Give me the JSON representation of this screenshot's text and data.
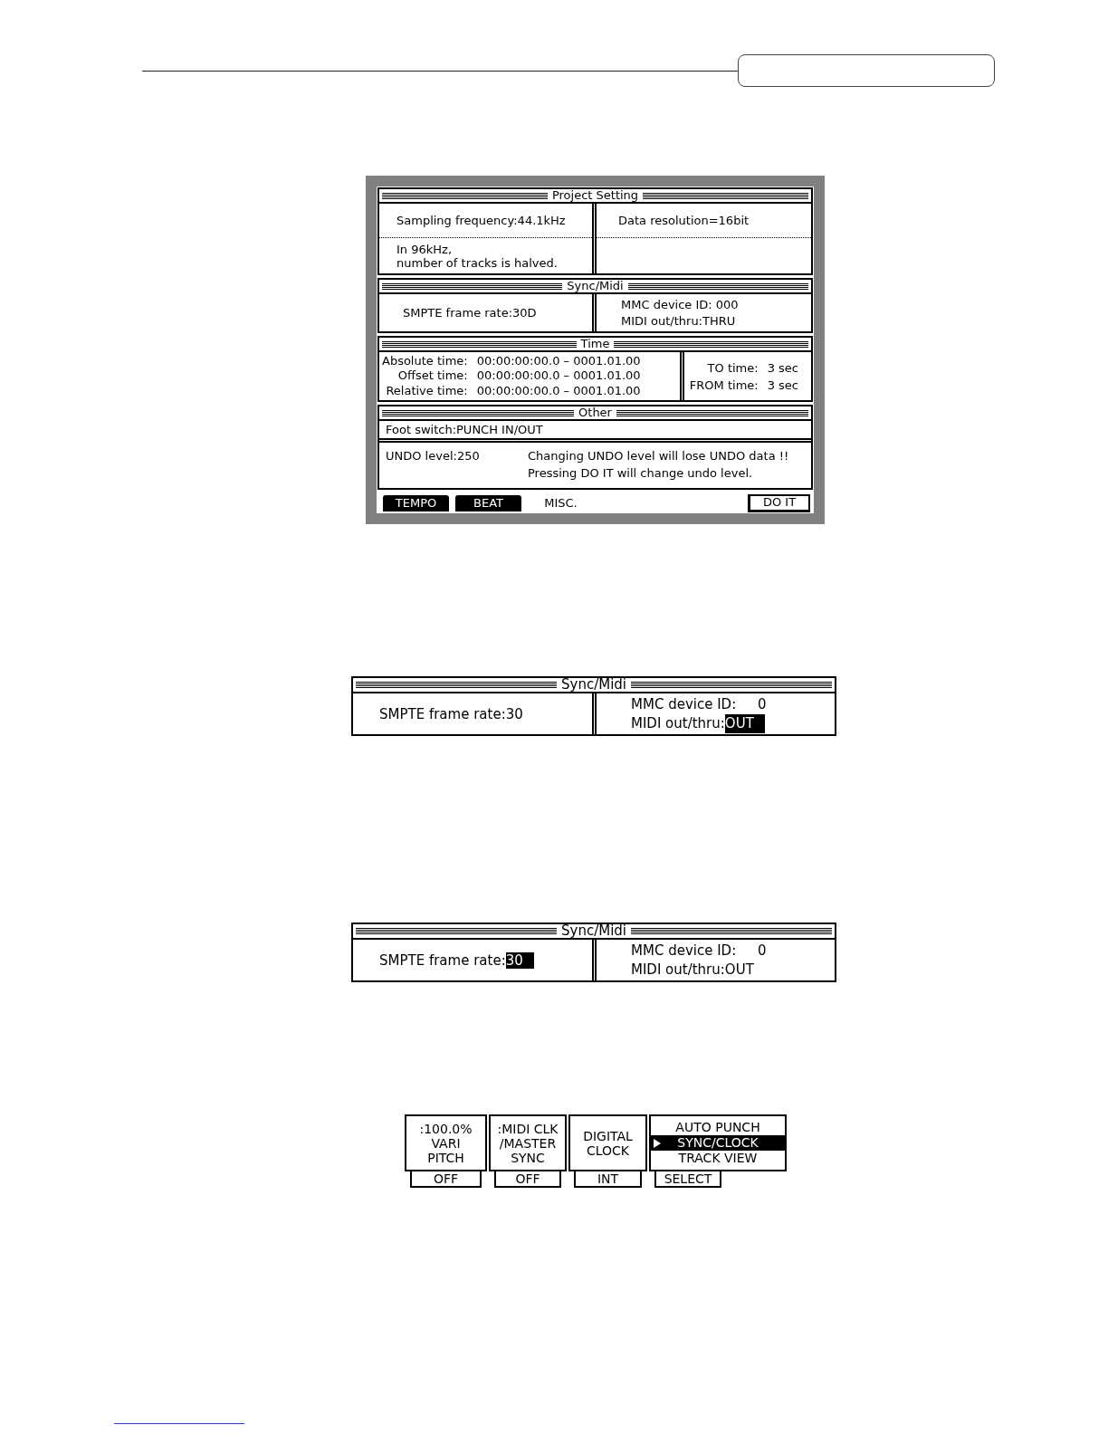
{
  "main_screen": {
    "project_setting": {
      "title": "Project Setting",
      "sampling_frequency": "Sampling frequency:44.1kHz",
      "data_resolution": "Data resolution=16bit",
      "note": [
        "In 96kHz,",
        "number of tracks is halved."
      ]
    },
    "sync_midi": {
      "title": "Sync/Midi",
      "fields": [
        {
          "kind": "choice",
          "label": "SMPTE frame rate:",
          "value": "30D",
          "selected": false
        },
        {
          "kind": "number",
          "label": "MMC device ID:",
          "value": "000",
          "selected": false
        },
        {
          "kind": "choice",
          "label": "MIDI out/thru:",
          "value": "THRU",
          "selected": false
        }
      ]
    },
    "time": {
      "title": "Time",
      "rows": [
        {
          "label": "Absolute time:",
          "value": "00:00:00:00.0 – 0001.01.00"
        },
        {
          "label": "Offset time:",
          "value": "00:00:00:00.0 – 0001.01.00"
        },
        {
          "label": "Relative time:",
          "value": "00:00:00:00.0 – 0001.01.00"
        }
      ],
      "transport": [
        {
          "label": "TO time:",
          "value": "3 sec"
        },
        {
          "label": "FROM time:",
          "value": "3 sec"
        }
      ]
    },
    "other": {
      "title": "Other",
      "foot_switch": "Foot switch:PUNCH IN/OUT",
      "undo_level": "UNDO level:250",
      "warnings": [
        "Changing UNDO level will lose UNDO data !!",
        "Pressing DO IT will change undo level."
      ]
    },
    "tabs": [
      {
        "label": "TEMPO",
        "selected": false
      },
      {
        "label": "BEAT",
        "selected": false
      },
      {
        "label": "MISC.",
        "selected": true
      }
    ],
    "action_button": "DO IT"
  },
  "sync_panels": [
    {
      "title": "Sync/Midi",
      "fields": [
        {
          "kind": "choice",
          "label": "SMPTE frame rate:",
          "value": "30",
          "selected": false
        },
        {
          "kind": "number",
          "label": "MMC device ID:",
          "value": "0",
          "selected": false
        },
        {
          "kind": "choice",
          "label": "MIDI out/thru:",
          "value": "OUT",
          "selected": true
        }
      ]
    },
    {
      "title": "Sync/Midi",
      "fields": [
        {
          "kind": "choice",
          "label": "SMPTE frame rate:",
          "value": "30",
          "selected": true
        },
        {
          "kind": "number",
          "label": "MMC device ID:",
          "value": "0",
          "selected": false
        },
        {
          "kind": "choice",
          "label": "MIDI out/thru:",
          "value": "OUT",
          "selected": false
        }
      ]
    }
  ],
  "function_keys": [
    {
      "kind": "toggle",
      "value": [
        ":100.0%"
      ],
      "label": [
        "VARI",
        "PITCH"
      ],
      "button": "OFF"
    },
    {
      "kind": "toggle",
      "value": [
        ":MIDI CLK",
        "/MASTER"
      ],
      "label": [
        "SYNC"
      ],
      "button": "OFF"
    },
    {
      "kind": "toggle",
      "label": [
        "DIGITAL",
        "CLOCK"
      ],
      "button": "INT"
    },
    {
      "kind": "menu",
      "items": [
        {
          "label": "AUTO PUNCH",
          "selected": false
        },
        {
          "label": "SYNC/CLOCK",
          "selected": true
        },
        {
          "label": "TRACK VIEW",
          "selected": false
        }
      ],
      "button": "SELECT"
    }
  ]
}
